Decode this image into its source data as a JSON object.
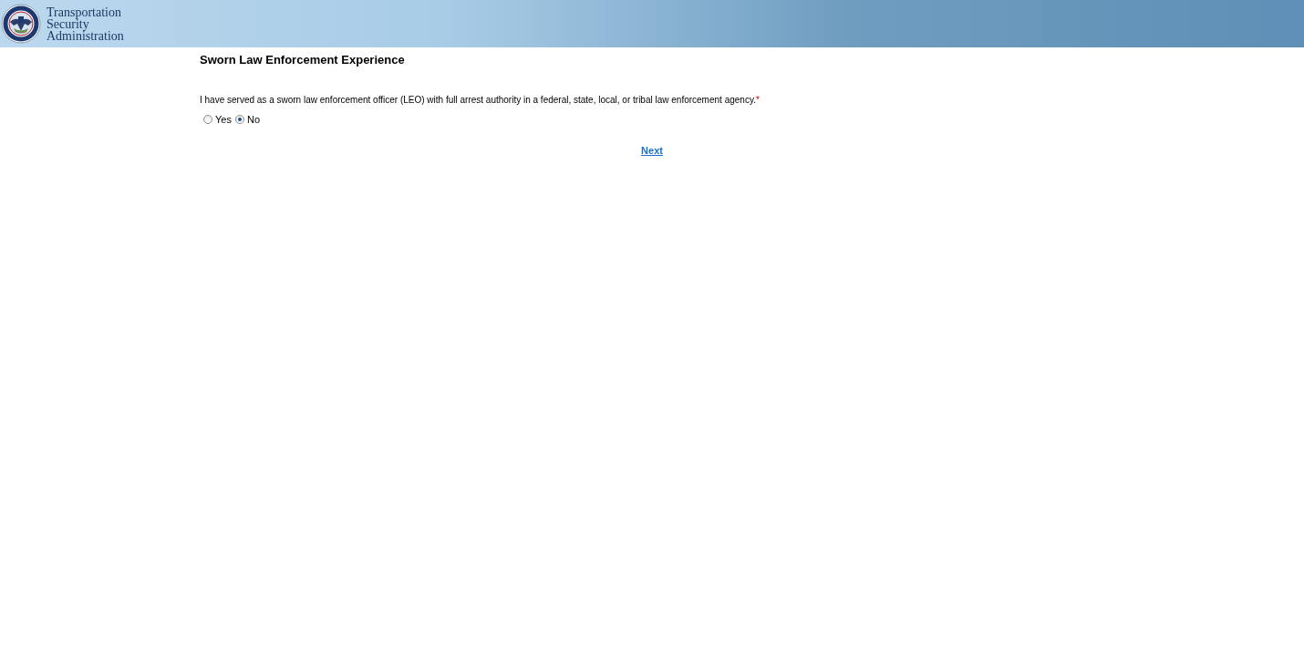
{
  "header": {
    "org_name": [
      "Transportation",
      "Security",
      "Administration"
    ]
  },
  "page": {
    "title": "Sworn Law Enforcement Experience"
  },
  "question": {
    "text": "I have served as a sworn law enforcement officer (LEO) with full arrest authority in a federal, state, local, or tribal law enforcement agency.",
    "required": true,
    "required_marker": "*",
    "options": [
      {
        "label": "Yes",
        "selected": false
      },
      {
        "label": "No",
        "selected": true
      }
    ]
  },
  "next_link": "Next"
}
